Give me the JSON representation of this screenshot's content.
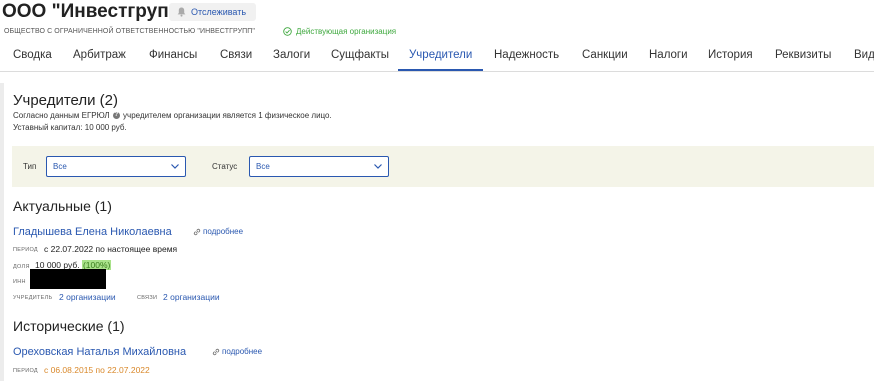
{
  "header": {
    "company_title": "ООО \"Инвестгрупп\"",
    "follow_label": "Отслеживать",
    "full_name": "ОБЩЕСТВО С ОГРАНИЧЕННОЙ ОТВЕТСТВЕННОСТЬЮ \"ИНВЕСТГРУПП\"",
    "status": "Действующая организация"
  },
  "tabs": [
    {
      "label": "Сводка"
    },
    {
      "label": "Арбитраж"
    },
    {
      "label": "Финансы"
    },
    {
      "label": "Связи"
    },
    {
      "label": "Залоги"
    },
    {
      "label": "Сущфакты"
    },
    {
      "label": "Учредители"
    },
    {
      "label": "Надежность"
    },
    {
      "label": "Санкции"
    },
    {
      "label": "Налоги"
    },
    {
      "label": "История"
    },
    {
      "label": "Реквизиты"
    },
    {
      "label": "Вид"
    }
  ],
  "active_tab": "Учредители",
  "founders": {
    "heading": "Учредители (2)",
    "desc_before": "Согласно данным ЕГРЮЛ",
    "desc_after": "учредителем организации является 1 физическое лицо.",
    "capital": "Уставный капитал: 10 000 руб."
  },
  "filters": {
    "type_label": "Тип",
    "type_value": "Все",
    "status_label": "Статус",
    "status_value": "Все"
  },
  "current": {
    "heading": "Актуальные (1)",
    "name": "Гладышева Елена Николаевна",
    "more_label": "подробнее",
    "period_label": "ПЕРИОД",
    "period_value": "с 22.07.2022 по настоящее время",
    "share_label": "ДОЛЯ",
    "share_value": "10 000 руб.",
    "share_percent": "(100%)",
    "inn_label": "ИНН",
    "founder_label": "УЧРЕДИТЕЛЬ",
    "founder_link": "2 организации",
    "links_label": "СВЯЗИ",
    "links_link": "2 организации"
  },
  "historical": {
    "heading": "Исторические (1)",
    "name": "Ореховская Наталья Михайловна",
    "more_label": "подробнее",
    "period_label": "ПЕРИОД",
    "period_value": "с 06.08.2015 по 22.07.2022"
  },
  "colors": {
    "accent": "#2a58b0",
    "status_green": "#3ea83e",
    "historical_orange": "#d9882a",
    "share_highlight": "#a9e28a",
    "filter_bg": "#f4f4e8"
  },
  "icons": [
    "bell-icon",
    "check-circle-icon",
    "info-icon",
    "chevron-down-icon",
    "link-icon"
  ]
}
